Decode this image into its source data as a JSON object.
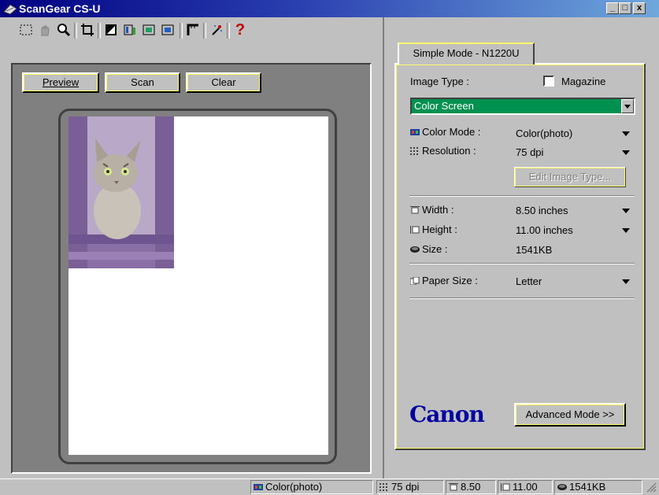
{
  "window": {
    "title": "ScanGear CS-U",
    "caption_buttons": [
      "_",
      "□",
      "x"
    ]
  },
  "toolbar": {
    "icons": [
      "marquee-icon",
      "hand-icon",
      "zoom-icon",
      "crop-icon",
      "exposure-icon",
      "color-adjust-icon",
      "auto-tone-icon",
      "levels-icon",
      "ruler-icon",
      "settings-icon",
      "help-icon"
    ]
  },
  "preview": {
    "buttons": {
      "preview": {
        "label": "Preview",
        "mnemonic": "P"
      },
      "scan": {
        "label": "Scan",
        "mnemonic": "S"
      },
      "clear": {
        "label": "Clear",
        "mnemonic": "C"
      }
    }
  },
  "settings": {
    "tab_label": "Simple Mode - N1220U",
    "image_type_label": "Image Type :",
    "magazine_label": "Magazine",
    "magazine_checked": false,
    "image_type_value": "Color Screen",
    "color_mode": {
      "label": "Color Mode :",
      "value": "Color(photo)"
    },
    "resolution": {
      "label": "Resolution :",
      "value": "75 dpi"
    },
    "edit_button": "Edit Image Type...",
    "width": {
      "label": "Width :",
      "value": "8.50 inches"
    },
    "height": {
      "label": "Height :",
      "value": "11.00 inches"
    },
    "size": {
      "label": "Size :",
      "value": "1541KB"
    },
    "paper_size": {
      "label": "Paper Size :",
      "value": "Letter"
    },
    "logo": "Canon",
    "advanced_button": "Advanced Mode >>"
  },
  "statusbar": {
    "color_mode": "Color(photo)",
    "resolution": "75 dpi",
    "width": "8.50",
    "height": "11.00",
    "size": "1541KB"
  },
  "colors": {
    "titlebar": "#000080",
    "selected_field": "#009050",
    "logo": "#0000a0",
    "focus_outline": "#ffff66"
  }
}
